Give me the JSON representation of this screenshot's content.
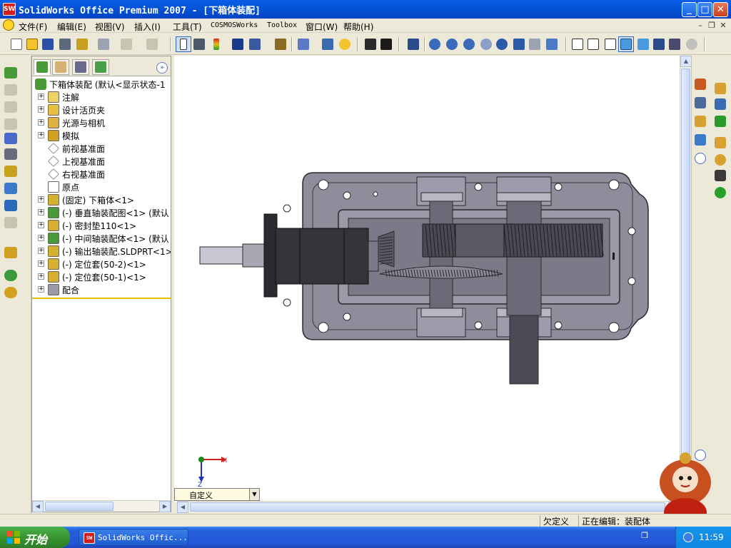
{
  "window": {
    "title": "SolidWorks Office Premium 2007 - [下箱体装配]",
    "app_icon_text": "SW"
  },
  "menu": {
    "items": [
      "文件(F)",
      "编辑(E)",
      "视图(V)",
      "插入(I)",
      "工具(T)",
      "COSMOSWorks",
      "Toolbox",
      "窗口(W)",
      "帮助(H)"
    ]
  },
  "feature_tree": {
    "root": "下箱体装配  (默认<显示状态-1",
    "items": [
      {
        "label": "注解",
        "icon": "annotation-icon",
        "expandable": true
      },
      {
        "label": "设计活页夹",
        "icon": "design-binder-icon",
        "expandable": true
      },
      {
        "label": "光源与相机",
        "icon": "lights-cameras-icon",
        "expandable": true
      },
      {
        "label": "模拟",
        "icon": "simulation-icon",
        "expandable": true
      },
      {
        "label": "前视基准面",
        "icon": "plane-icon",
        "expandable": false
      },
      {
        "label": "上视基准面",
        "icon": "plane-icon",
        "expandable": false
      },
      {
        "label": "右视基准面",
        "icon": "plane-icon",
        "expandable": false
      },
      {
        "label": "原点",
        "icon": "origin-icon",
        "expandable": false
      },
      {
        "label": "(固定) 下箱体<1>",
        "icon": "part-icon",
        "expandable": true
      },
      {
        "label": "(-) 垂直轴装配图<1> (默认",
        "icon": "subassembly-icon",
        "expandable": true
      },
      {
        "label": "(-) 密封垫110<1>",
        "icon": "part-icon",
        "expandable": true
      },
      {
        "label": "(-) 中间轴装配体<1> (默认",
        "icon": "subassembly-icon",
        "expandable": true
      },
      {
        "label": "(-) 输出轴装配.SLDPRT<1>",
        "icon": "part-icon",
        "expandable": true
      },
      {
        "label": "(-) 定位套(50-2)<1>",
        "icon": "part-icon",
        "expandable": true
      },
      {
        "label": "(-) 定位套(50-1)<1>",
        "icon": "part-icon",
        "expandable": true
      },
      {
        "label": "配合",
        "icon": "mates-icon",
        "expandable": true
      }
    ]
  },
  "triad": {
    "x_label": "X",
    "z_label": "Z"
  },
  "config_select": {
    "value": "自定义"
  },
  "status": {
    "definition": "欠定义",
    "editing": "正在编辑：装配体"
  },
  "taskbar": {
    "start_label": "开始",
    "task_label": "SolidWorks Offic...",
    "clock": "11:59"
  },
  "colors": {
    "titlebar": "#0454d8",
    "housing": "#8a8a9a",
    "gear": "#4a4a4a",
    "shaft": "#5a5a5a"
  }
}
